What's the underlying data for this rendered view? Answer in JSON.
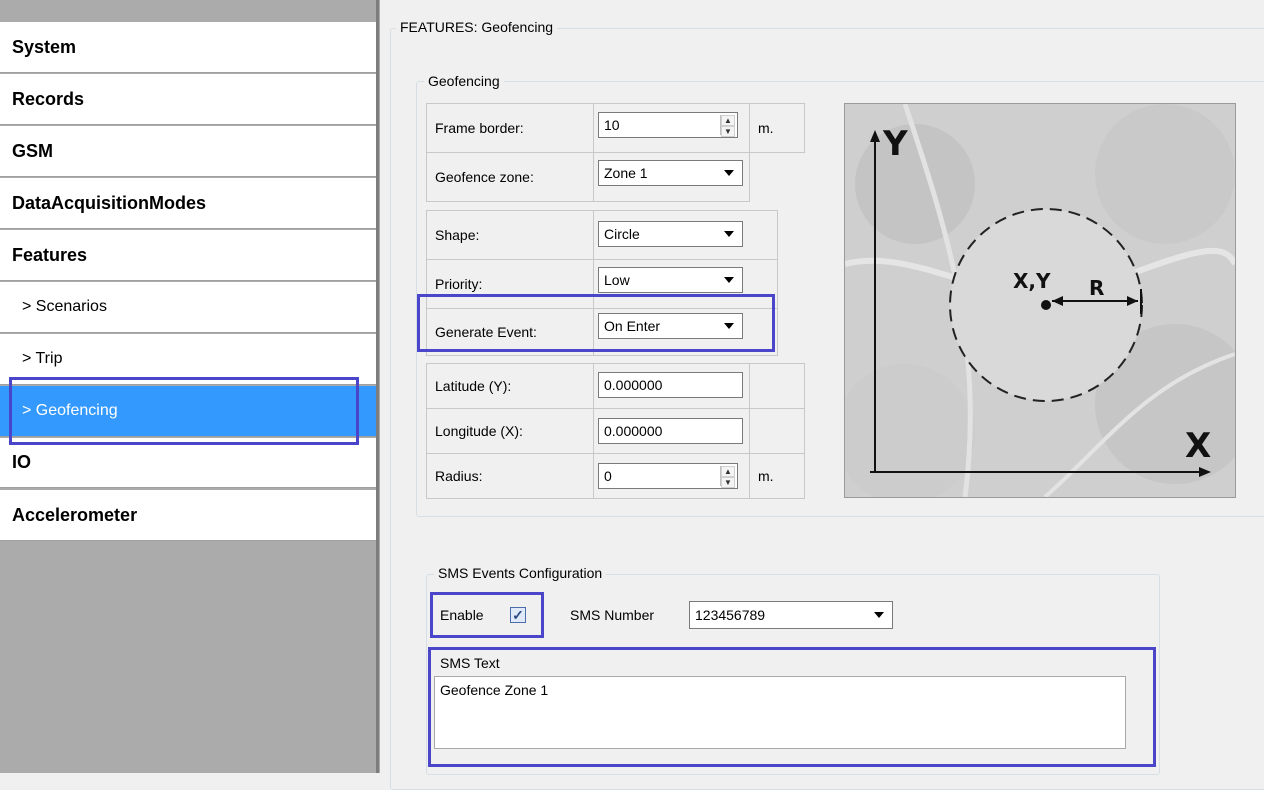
{
  "sidebar": {
    "items": [
      {
        "label": "System"
      },
      {
        "label": "Records"
      },
      {
        "label": "GSM"
      },
      {
        "label": "DataAcquisitionModes"
      },
      {
        "label": "Features"
      },
      {
        "label": "> Scenarios"
      },
      {
        "label": "> Trip"
      },
      {
        "label": "> Geofencing"
      },
      {
        "label": "IO"
      },
      {
        "label": "Accelerometer"
      }
    ]
  },
  "main": {
    "outer_title": "FEATURES: Geofencing",
    "geofencing_title": "Geofencing",
    "frame_border": {
      "label": "Frame border:",
      "value": "10",
      "unit": "m."
    },
    "geofence_zone": {
      "label": "Geofence zone:",
      "value": "Zone 1"
    },
    "shape": {
      "label": "Shape:",
      "value": "Circle"
    },
    "priority": {
      "label": "Priority:",
      "value": "Low"
    },
    "generate_event": {
      "label": "Generate Event:",
      "value": "On Enter"
    },
    "latitude": {
      "label": "Latitude (Y):",
      "value": "0.000000"
    },
    "longitude": {
      "label": "Longitude (X):",
      "value": "0.000000"
    },
    "radius": {
      "label": "Radius:",
      "value": "0",
      "unit": "m."
    },
    "diagram": {
      "y": "Y",
      "x": "X",
      "center": "X,Y",
      "r": "R"
    },
    "sms": {
      "title": "SMS Events Configuration",
      "enable_label": "Enable",
      "enable_checked": true,
      "number_label": "SMS Number",
      "number_value": "123456789",
      "text_label": "SMS Text",
      "text_value": "Geofence Zone 1"
    }
  },
  "colors": {
    "highlight": "#4b45c9",
    "selected": "#3399ff"
  }
}
